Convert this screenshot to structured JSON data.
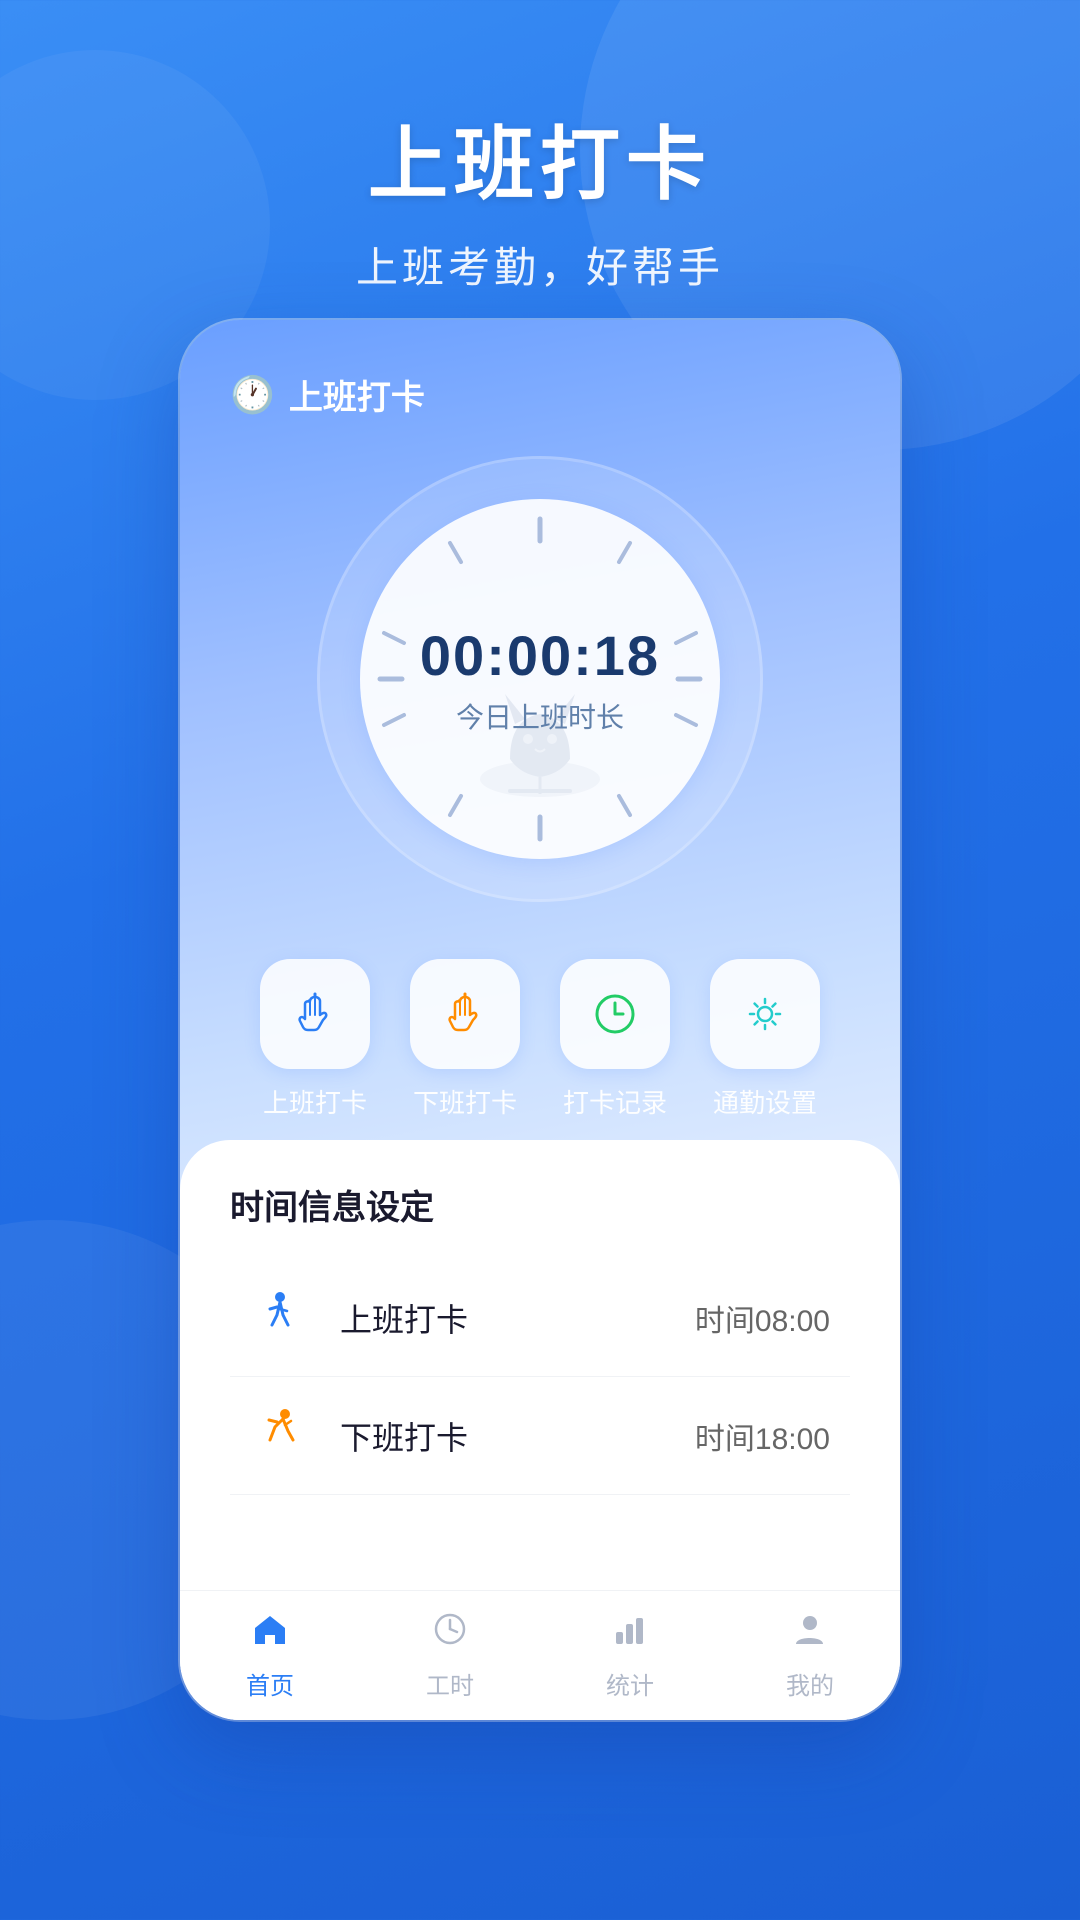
{
  "app": {
    "background_color": "#2a7af5"
  },
  "header": {
    "title": "上班打卡",
    "subtitle": "上班考勤，好帮手"
  },
  "phone": {
    "topbar": {
      "icon": "🕐",
      "title": "上班打卡"
    },
    "clock": {
      "time": "00:00:18",
      "label": "今日上班时长"
    },
    "action_buttons": [
      {
        "id": "checkin",
        "icon_color": "#2b7ef5",
        "label": "上班打卡"
      },
      {
        "id": "checkout",
        "icon_color": "#ff8c00",
        "label": "下班打卡"
      },
      {
        "id": "records",
        "icon_color": "#22cc66",
        "label": "打卡记录"
      },
      {
        "id": "settings",
        "icon_color": "#22cccc",
        "label": "通勤设置"
      }
    ],
    "time_settings": {
      "section_title": "时间信息设定",
      "rows": [
        {
          "id": "work_checkin",
          "icon": "🚶",
          "icon_color": "#2b7ef5",
          "name": "上班打卡",
          "time_label": "时间",
          "time_value": "08:00"
        },
        {
          "id": "work_checkout",
          "icon": "🏃",
          "icon_color": "#ff8c00",
          "name": "下班打卡",
          "time_label": "时间",
          "time_value": "18:00"
        }
      ]
    },
    "bottom_nav": [
      {
        "id": "home",
        "icon": "⌂",
        "label": "首页",
        "active": true
      },
      {
        "id": "hours",
        "icon": "⏱",
        "label": "工时",
        "active": false
      },
      {
        "id": "stats",
        "icon": "📊",
        "label": "统计",
        "active": false
      },
      {
        "id": "mine",
        "icon": "👤",
        "label": "我的",
        "active": false
      }
    ]
  }
}
